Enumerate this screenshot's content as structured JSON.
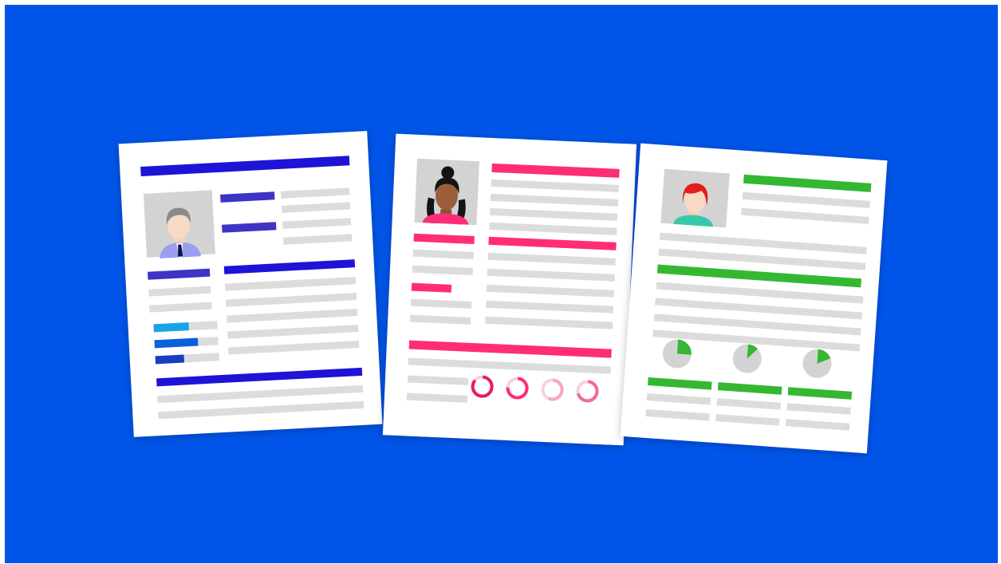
{
  "illustration": {
    "subject": "resume-documents",
    "colors": {
      "background": "#0055e8",
      "paper": "#ffffff",
      "placeholder_line": "#dcdcdc",
      "photo_frame": "#d3d3d3"
    },
    "resumes": [
      {
        "accent": "#1e13d6",
        "accent_light": "#3d34c6",
        "photo_icon": "man-avatar-icon",
        "skill_levels": [
          0.55,
          0.68,
          0.45
        ]
      },
      {
        "accent": "#ff2d78",
        "accent_light": "#f5a6c4",
        "photo_icon": "woman-avatar-icon",
        "ring_levels": [
          0.85,
          0.75,
          0.55,
          0.7
        ]
      },
      {
        "accent": "#35b732",
        "accent_light": "#dcdcdc",
        "photo_icon": "redhead-avatar-icon",
        "pie_levels": [
          0.25,
          0.12,
          0.18
        ]
      }
    ]
  }
}
